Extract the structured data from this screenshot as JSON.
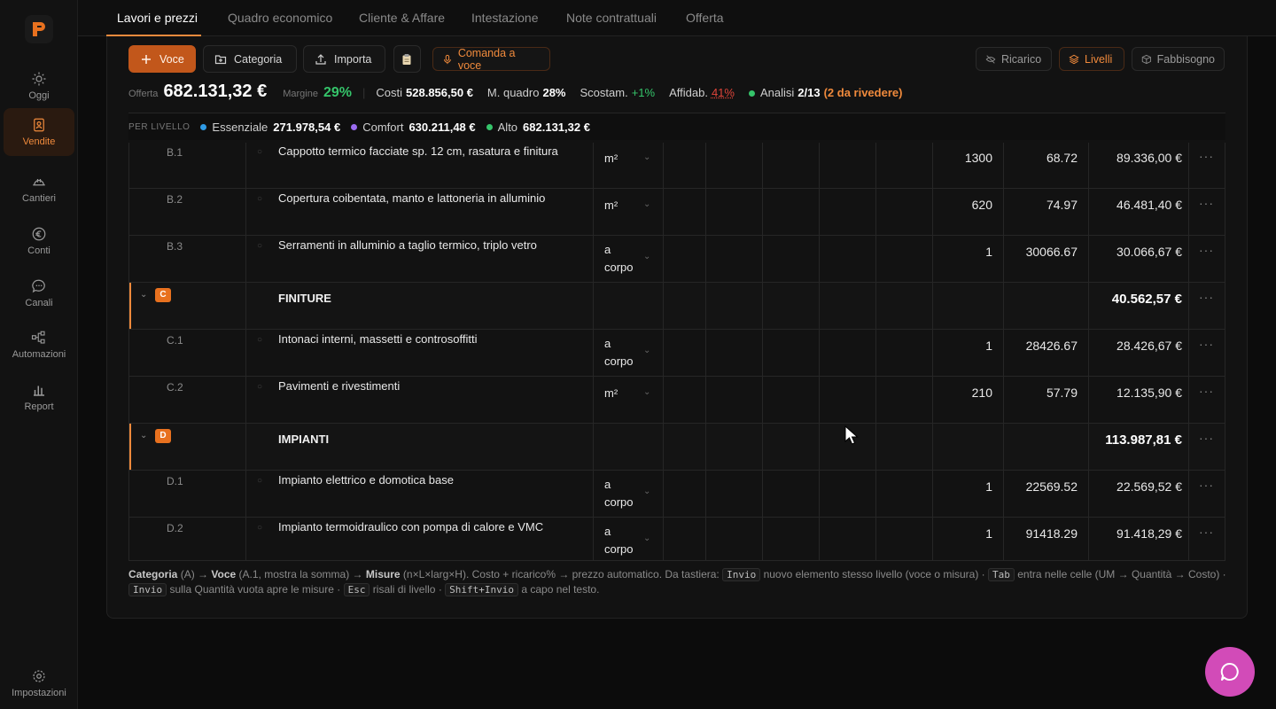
{
  "sidebar": {
    "items": [
      {
        "label": "Oggi",
        "icon": "sun-icon"
      },
      {
        "label": "Vendite",
        "icon": "contacts-icon",
        "active": true
      },
      {
        "label": "Cantieri",
        "icon": "helmet-icon"
      },
      {
        "label": "Conti",
        "icon": "euro-icon"
      },
      {
        "label": "Canali",
        "icon": "chat-icon"
      },
      {
        "label": "Automazioni",
        "icon": "workflow-icon"
      },
      {
        "label": "Report",
        "icon": "bar-chart-icon"
      }
    ],
    "settings": "Impostazioni"
  },
  "tabs": [
    "Lavori e prezzi",
    "Quadro economico",
    "Cliente & Affare",
    "Intestazione",
    "Note contrattuali",
    "Offerta"
  ],
  "toolbar": {
    "voce": "Voce",
    "categoria": "Categoria",
    "importa": "Importa",
    "comanda": "Comanda a voce",
    "ricarico": "Ricarico",
    "livelli": "Livelli",
    "fabbisogno": "Fabbisogno"
  },
  "stats": {
    "offerta_label": "Offerta",
    "offerta_value": "682.131,32 €",
    "margine_label": "Margine",
    "margine_value": "29%",
    "costi_label": "Costi",
    "costi_value": "528.856,50 €",
    "mquadro_label": "M. quadro",
    "mquadro_value": "28%",
    "scostam_label": "Scostam.",
    "scostam_value": "+1%",
    "affidab_label": "Affidab.",
    "affidab_value": "41%",
    "analisi_label": "Analisi",
    "analisi_value": "2/13",
    "analisi_note": "(2 da rivedere)"
  },
  "levels": {
    "label": "PER LIVELLO",
    "items": [
      {
        "name": "Essenziale",
        "value": "271.978,54 €",
        "color": "#2f9be6"
      },
      {
        "name": "Comfort",
        "value": "630.211,48 €",
        "color": "#9b6cf0"
      },
      {
        "name": "Alto",
        "value": "682.131,32 €",
        "color": "#35c46a"
      }
    ]
  },
  "rows": [
    {
      "type": "item",
      "code": "B.1",
      "desc": "Cappotto termico facciate sp. 12 cm, rasatura e finitura",
      "um": "m²",
      "qty": "1300",
      "cost": "68.72",
      "total": "89.336,00 €"
    },
    {
      "type": "item",
      "code": "B.2",
      "desc": "Copertura coibentata, manto e lattoneria in alluminio",
      "um": "m²",
      "qty": "620",
      "cost": "74.97",
      "total": "46.481,40 €"
    },
    {
      "type": "item",
      "code": "B.3",
      "desc": "Serramenti in alluminio a taglio termico, triplo vetro",
      "um": "a corpo",
      "qty": "1",
      "cost": "30066.67",
      "total": "30.066,67 €"
    },
    {
      "type": "cat",
      "code": "C",
      "desc": "FINITURE",
      "total": "40.562,57 €"
    },
    {
      "type": "item",
      "code": "C.1",
      "desc": "Intonaci interni, massetti e controsoffitti",
      "um": "a corpo",
      "qty": "1",
      "cost": "28426.67",
      "total": "28.426,67 €"
    },
    {
      "type": "item",
      "code": "C.2",
      "desc": "Pavimenti e rivestimenti",
      "um": "m²",
      "qty": "210",
      "cost": "57.79",
      "total": "12.135,90 €"
    },
    {
      "type": "cat",
      "code": "D",
      "desc": "IMPIANTI",
      "total": "113.987,81 €"
    },
    {
      "type": "item",
      "code": "D.1",
      "desc": "Impianto elettrico e domotica base",
      "um": "a corpo",
      "qty": "1",
      "cost": "22569.52",
      "total": "22.569,52 €"
    },
    {
      "type": "item",
      "code": "D.2",
      "desc": "Impianto termoidraulico con pompa di calore e VMC",
      "um": "a corpo",
      "qty": "1",
      "cost": "91418.29",
      "total": "91.418,29 €"
    }
  ],
  "help": {
    "t1": "Categoria",
    "t2": "(A) → ",
    "t3": "Voce",
    "t4": "(A.1, mostra la somma) → ",
    "t5": "Misure",
    "t6": "(n×L×larg×H). Costo + ricarico% → prezzo automatico. Da tastiera:",
    "k1": "Invio",
    "t7": "nuovo elemento stesso livello (voce o misura) ·",
    "k2": "Tab",
    "t8": "entra nelle celle (UM → Quantità → Costo) ·",
    "k3": "Invio",
    "t9": "sulla Quantità vuota apre le misure ·",
    "k4": "Esc",
    "t10": "risali di livello ·",
    "k5": "Shift+Invio",
    "t11": "a capo nel testo."
  }
}
